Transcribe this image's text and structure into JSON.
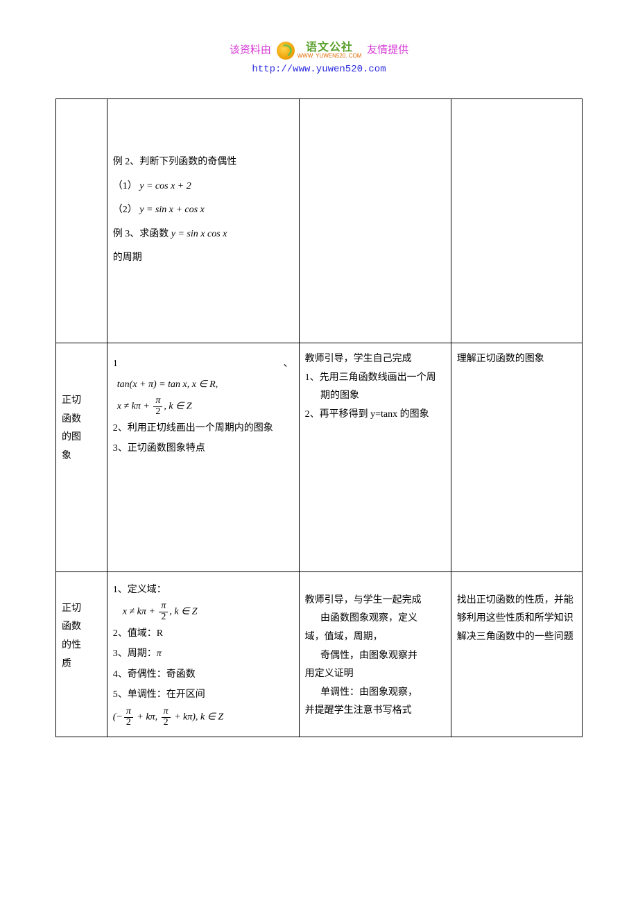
{
  "header": {
    "left": "该资料由",
    "logo_cn": "语文公社",
    "logo_en": "WWW. YUWEN520. COM",
    "right": "友情提供",
    "url": "http://www.yuwen520.com"
  },
  "rows": [
    {
      "col1_lines": [
        "",
        "",
        "",
        ""
      ],
      "col2": {
        "ex2_title": "例 2、判断下列函数的奇偶性",
        "ex2_item1_label": "（1）",
        "ex2_item1_expr": "y = cos x + 2",
        "ex2_item2_label": "（2）",
        "ex2_item2_expr": "y = sin x + cos x",
        "ex3_title_prefix": "例 3、求函数 ",
        "ex3_expr": "y = sin x cos x",
        "ex3_suffix": "的周期"
      },
      "col3": "",
      "col4": ""
    },
    {
      "col1_lines": [
        "正 切",
        "函 数",
        "的 图",
        "象"
      ],
      "col2": {
        "item1_num": "1",
        "item1_dun": "、",
        "item1_expr_l1": "tan(x + π) = tan x, x ∈ R,",
        "item1_expr_l2_pre": "x ≠ kπ + ",
        "item1_expr_l2_frac_num": "π",
        "item1_expr_l2_frac_den": "2",
        "item1_expr_l2_post": ", k ∈ Z",
        "item2": "2、利用正切线画出一个周期内的图象",
        "item3": "3、正切函数图象特点"
      },
      "col3": {
        "line1": "教师引导，学生自己完成",
        "line2": "1、先用三角函数线画出一个周期的图象",
        "line3": "2、再平移得到 y=tanx 的图象"
      },
      "col4": "理解正切函数的图象"
    },
    {
      "col1_lines": [
        "正 切",
        "函 数",
        "的 性",
        "质"
      ],
      "col2": {
        "item1_label": "1、定义域：",
        "item1_expr_pre": "x ≠ kπ + ",
        "item1_frac_num": "π",
        "item1_frac_den": "2",
        "item1_expr_post": ", k ∈ Z",
        "item2": "2、值域：R",
        "item3_label": "3、周期：",
        "item3_val": "π",
        "item4": "4、奇偶性：奇函数",
        "item5_label": "5、单调性：在开区间",
        "item5_expr_pre": "(−",
        "item5_frac1_num": "π",
        "item5_frac1_den": "2",
        "item5_mid": " + kπ, ",
        "item5_frac2_num": "π",
        "item5_frac2_den": "2",
        "item5_expr_post": " + kπ), k ∈ Z"
      },
      "col3": {
        "l1": "教师引导，与学生一起完成",
        "l2": "由函数图象观察，定义",
        "l3": "域，值域，周期，",
        "l4": "奇偶性，由图象观察并",
        "l5": "用定义证明",
        "l6": "单调性：由图象观察，",
        "l7": "并提醒学生注意书写格式"
      },
      "col4": "找出正切函数的性质，并能够利用这些性质和所学知识解决三角函数中的一些问题"
    }
  ]
}
